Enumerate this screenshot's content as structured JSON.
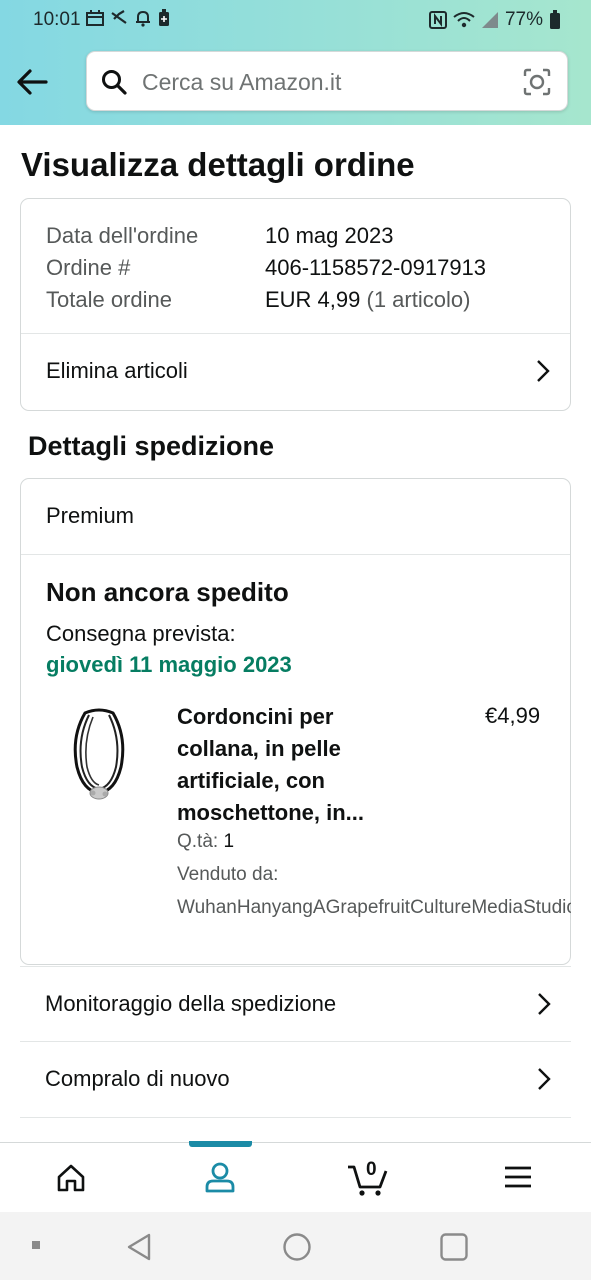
{
  "status_bar": {
    "time": "10:01",
    "battery": "77%"
  },
  "search": {
    "placeholder": "Cerca su Amazon.it"
  },
  "page_title": "Visualizza dettagli ordine",
  "order_summary": {
    "rows": [
      {
        "label": "Data dell'ordine",
        "value": "10 mag 2023",
        "extra": ""
      },
      {
        "label": "Ordine #",
        "value": "406-1158572-0917913",
        "extra": ""
      },
      {
        "label": "Totale ordine",
        "value": "EUR 4,99",
        "extra": " (1 articolo)"
      }
    ],
    "delete_items": "Elimina articoli"
  },
  "shipping": {
    "title": "Dettagli spedizione",
    "method": "Premium",
    "status": "Non ancora spedito",
    "delivery_label": "Consegna prevista:",
    "delivery_date": "giovedì 11 maggio 2023",
    "product": {
      "title_lines": [
        "Cordoncini per",
        "collana, in pelle",
        "artificiale, con",
        "moschettone, in..."
      ],
      "price": "€4,99",
      "qty_label": "Q.tà:",
      "qty_value": "1",
      "sold_by_label": "Venduto da:",
      "seller": "WuhanHanyangAGrapefruitCultureMediaStudio"
    }
  },
  "actions": {
    "track": "Monitoraggio della spedizione",
    "buy_again": "Compralo di nuovo"
  },
  "bottom_nav": {
    "cart_count": "0",
    "items": [
      "home-icon",
      "account-icon",
      "cart-icon",
      "menu-icon"
    ]
  },
  "colors": {
    "accent": "#1b8ba6",
    "delivery_green": "#067d62",
    "header_from": "#84d8e3",
    "header_to": "#a6e6ce"
  }
}
